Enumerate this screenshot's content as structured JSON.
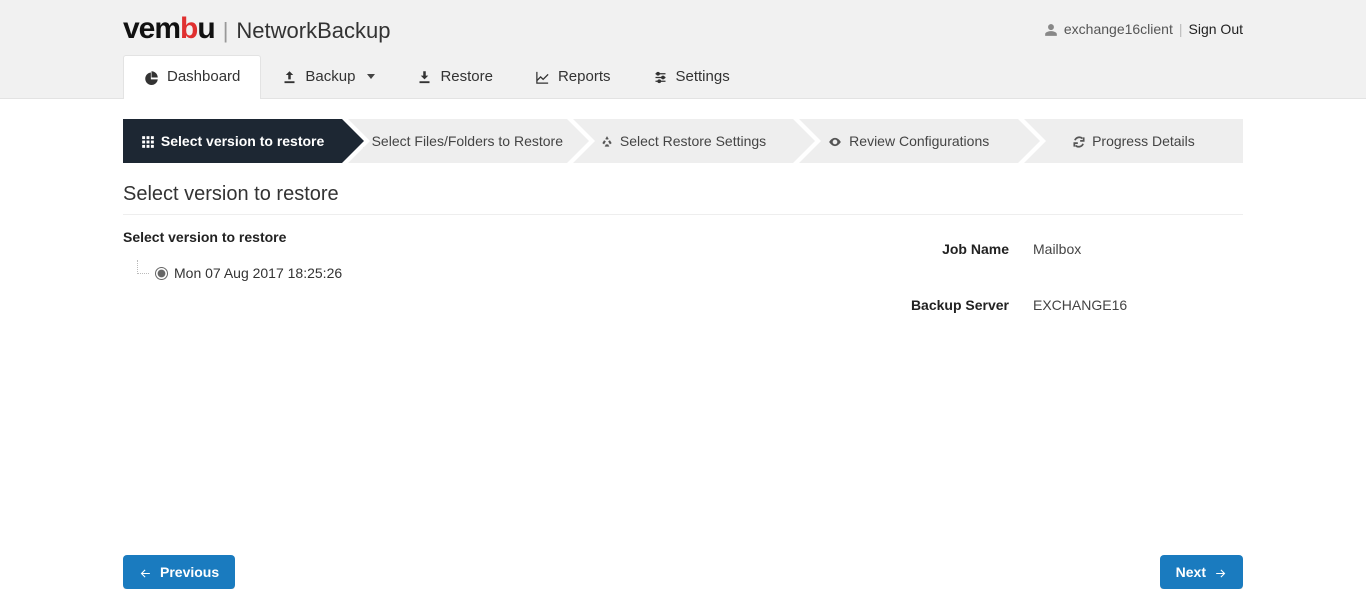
{
  "header": {
    "brand_product": "NetworkBackup",
    "username": " exchange16client ",
    "signout": "Sign Out"
  },
  "nav": {
    "dashboard": "Dashboard",
    "backup": "Backup",
    "restore": "Restore",
    "reports": "Reports",
    "settings": "Settings"
  },
  "wizard": {
    "step1": "Select version to restore",
    "step2": "Select Files/Folders to Restore",
    "step3": "Select Restore Settings",
    "step4": "Review Configurations",
    "step5": "Progress Details"
  },
  "page": {
    "title": "Select version to restore",
    "subheading": "Select version to restore"
  },
  "versions": [
    {
      "label": "Mon 07 Aug 2017 18:25:26",
      "selected": true
    }
  ],
  "job": {
    "jobname_label": "Job Name",
    "jobname_value": "Mailbox",
    "backupserver_label": "Backup Server",
    "backupserver_value": "EXCHANGE16"
  },
  "buttons": {
    "previous": "Previous",
    "next": "Next"
  }
}
